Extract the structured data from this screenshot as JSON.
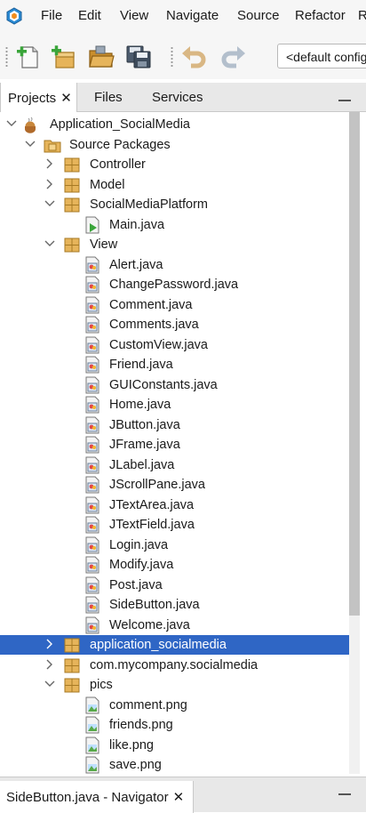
{
  "menubar": {
    "items": [
      "File",
      "Edit",
      "View",
      "Navigate",
      "Source",
      "Refactor",
      "R"
    ]
  },
  "toolbar": {
    "buttons": [
      "new-file-icon",
      "new-project-icon",
      "open-project-icon",
      "save-all-icon",
      "undo-icon",
      "redo-icon"
    ],
    "config_value": "<default config>"
  },
  "tabs": {
    "projects": "Projects",
    "files": "Files",
    "services": "Services"
  },
  "tree": {
    "rows": [
      {
        "label": "Application_SocialMedia",
        "icon": "project-icon",
        "indent": 0,
        "arrow": "expanded"
      },
      {
        "label": "Source Packages",
        "icon": "source-packages-icon",
        "indent": 1,
        "arrow": "expanded"
      },
      {
        "label": "Controller",
        "icon": "package-icon",
        "indent": 2,
        "arrow": "collapsed"
      },
      {
        "label": "Model",
        "icon": "package-icon",
        "indent": 2,
        "arrow": "collapsed"
      },
      {
        "label": "SocialMediaPlatform",
        "icon": "package-icon",
        "indent": 2,
        "arrow": "expanded"
      },
      {
        "label": "Main.java",
        "icon": "java-main-icon",
        "indent": 3,
        "arrow": "none"
      },
      {
        "label": "View",
        "icon": "package-icon",
        "indent": 2,
        "arrow": "expanded"
      },
      {
        "label": "Alert.java",
        "icon": "java-form-icon",
        "indent": 3,
        "arrow": "none"
      },
      {
        "label": "ChangePassword.java",
        "icon": "java-form-icon",
        "indent": 3,
        "arrow": "none"
      },
      {
        "label": "Comment.java",
        "icon": "java-form-icon",
        "indent": 3,
        "arrow": "none"
      },
      {
        "label": "Comments.java",
        "icon": "java-form-icon",
        "indent": 3,
        "arrow": "none"
      },
      {
        "label": "CustomView.java",
        "icon": "java-form-icon",
        "indent": 3,
        "arrow": "none"
      },
      {
        "label": "Friend.java",
        "icon": "java-form-icon",
        "indent": 3,
        "arrow": "none"
      },
      {
        "label": "GUIConstants.java",
        "icon": "java-form-icon",
        "indent": 3,
        "arrow": "none"
      },
      {
        "label": "Home.java",
        "icon": "java-form-icon",
        "indent": 3,
        "arrow": "none"
      },
      {
        "label": "JButton.java",
        "icon": "java-form-icon",
        "indent": 3,
        "arrow": "none"
      },
      {
        "label": "JFrame.java",
        "icon": "java-form-icon",
        "indent": 3,
        "arrow": "none"
      },
      {
        "label": "JLabel.java",
        "icon": "java-form-icon",
        "indent": 3,
        "arrow": "none"
      },
      {
        "label": "JScrollPane.java",
        "icon": "java-form-icon",
        "indent": 3,
        "arrow": "none"
      },
      {
        "label": "JTextArea.java",
        "icon": "java-form-icon",
        "indent": 3,
        "arrow": "none"
      },
      {
        "label": "JTextField.java",
        "icon": "java-form-icon",
        "indent": 3,
        "arrow": "none"
      },
      {
        "label": "Login.java",
        "icon": "java-form-icon",
        "indent": 3,
        "arrow": "none"
      },
      {
        "label": "Modify.java",
        "icon": "java-form-icon",
        "indent": 3,
        "arrow": "none"
      },
      {
        "label": "Post.java",
        "icon": "java-form-icon",
        "indent": 3,
        "arrow": "none"
      },
      {
        "label": "SideButton.java",
        "icon": "java-form-icon",
        "indent": 3,
        "arrow": "none"
      },
      {
        "label": "Welcome.java",
        "icon": "java-form-icon",
        "indent": 3,
        "arrow": "none"
      },
      {
        "label": "application_socialmedia",
        "icon": "package-icon",
        "indent": 2,
        "arrow": "collapsed",
        "selected": true
      },
      {
        "label": "com.mycompany.socialmedia",
        "icon": "package-icon",
        "indent": 2,
        "arrow": "collapsed"
      },
      {
        "label": "pics",
        "icon": "package-icon",
        "indent": 2,
        "arrow": "expanded"
      },
      {
        "label": "comment.png",
        "icon": "image-file-icon",
        "indent": 3,
        "arrow": "none"
      },
      {
        "label": "friends.png",
        "icon": "image-file-icon",
        "indent": 3,
        "arrow": "none"
      },
      {
        "label": "like.png",
        "icon": "image-file-icon",
        "indent": 3,
        "arrow": "none"
      },
      {
        "label": "save.png",
        "icon": "image-file-icon",
        "indent": 3,
        "arrow": "none"
      }
    ]
  },
  "navigator": {
    "title": "SideButton.java - Navigator"
  },
  "colors": {
    "selection": "#2f66c5",
    "package": "#e6b45a",
    "chrome": "#f6f6f6"
  }
}
